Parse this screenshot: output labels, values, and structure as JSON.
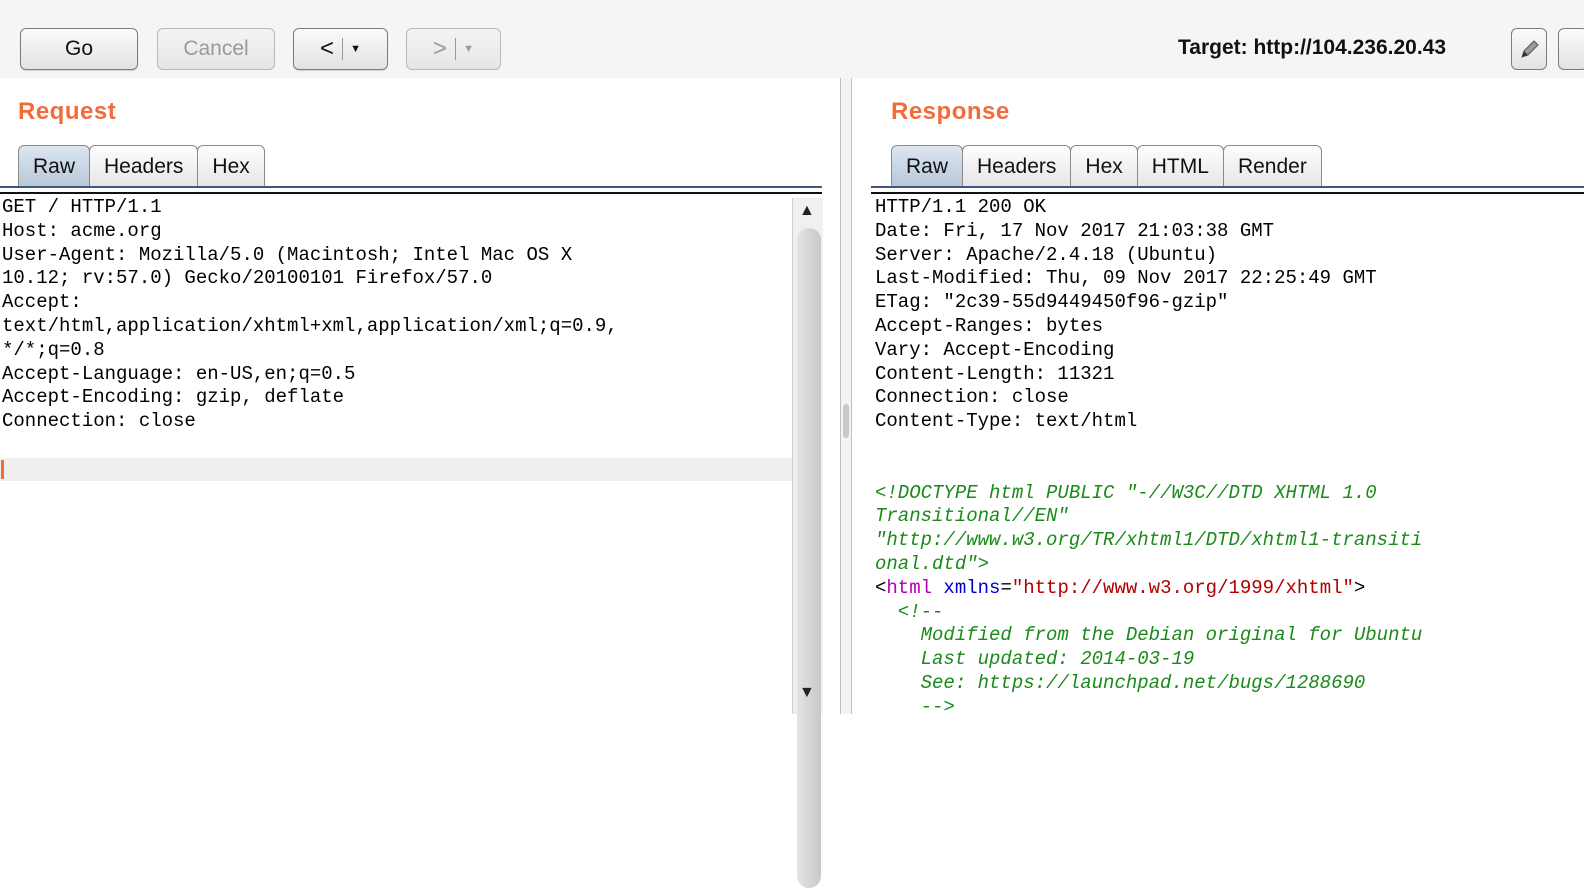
{
  "toolbar": {
    "go_label": "Go",
    "cancel_label": "Cancel",
    "back_label": "<",
    "forward_label": ">",
    "target_label": "Target: http://104.236.20.43"
  },
  "request": {
    "title": "Request",
    "tabs": [
      "Raw",
      "Headers",
      "Hex"
    ],
    "active_tab": "Raw",
    "lines": [
      "GET / HTTP/1.1",
      "Host: acme.org",
      "User-Agent: Mozilla/5.0 (Macintosh; Intel Mac OS X",
      "10.12; rv:57.0) Gecko/20100101 Firefox/57.0",
      "Accept:",
      "text/html,application/xhtml+xml,application/xml;q=0.9,",
      "*/*;q=0.8",
      "Accept-Language: en-US,en;q=0.5",
      "Accept-Encoding: gzip, deflate",
      "Connection: close"
    ]
  },
  "response": {
    "title": "Response",
    "tabs": [
      "Raw",
      "Headers",
      "Hex",
      "HTML",
      "Render"
    ],
    "active_tab": "Raw",
    "header_lines": [
      "HTTP/1.1 200 OK",
      "Date: Fri, 17 Nov 2017 21:03:38 GMT",
      "Server: Apache/2.4.18 (Ubuntu)",
      "Last-Modified: Thu, 09 Nov 2017 22:25:49 GMT",
      "ETag: \"2c39-55d9449450f96-gzip\"",
      "Accept-Ranges: bytes",
      "Vary: Accept-Encoding",
      "Content-Length: 11321",
      "Connection: close",
      "Content-Type: text/html"
    ],
    "doctype_lines": [
      "<!DOCTYPE html PUBLIC \"-//W3C//DTD XHTML 1.0",
      "Transitional//EN\"",
      "\"http://www.w3.org/TR/xhtml1/DTD/xhtml1-transiti",
      "onal.dtd\">"
    ],
    "html_tag": {
      "open": "<",
      "name": "html",
      "attr": "xmlns",
      "eq": "=",
      "value": "\"http://www.w3.org/1999/xhtml\"",
      "close": ">"
    },
    "comment_lines": [
      "  <!--",
      "    Modified from the Debian original for Ubuntu",
      "    Last updated: 2014-03-19",
      "    See: https://launchpad.net/bugs/1288690",
      "    -->"
    ]
  },
  "colors": {
    "accent": "#f26b3a",
    "comment": "#1a8a1a",
    "tag": "#b000b0",
    "attr": "#0000c8",
    "value": "#b00000"
  }
}
